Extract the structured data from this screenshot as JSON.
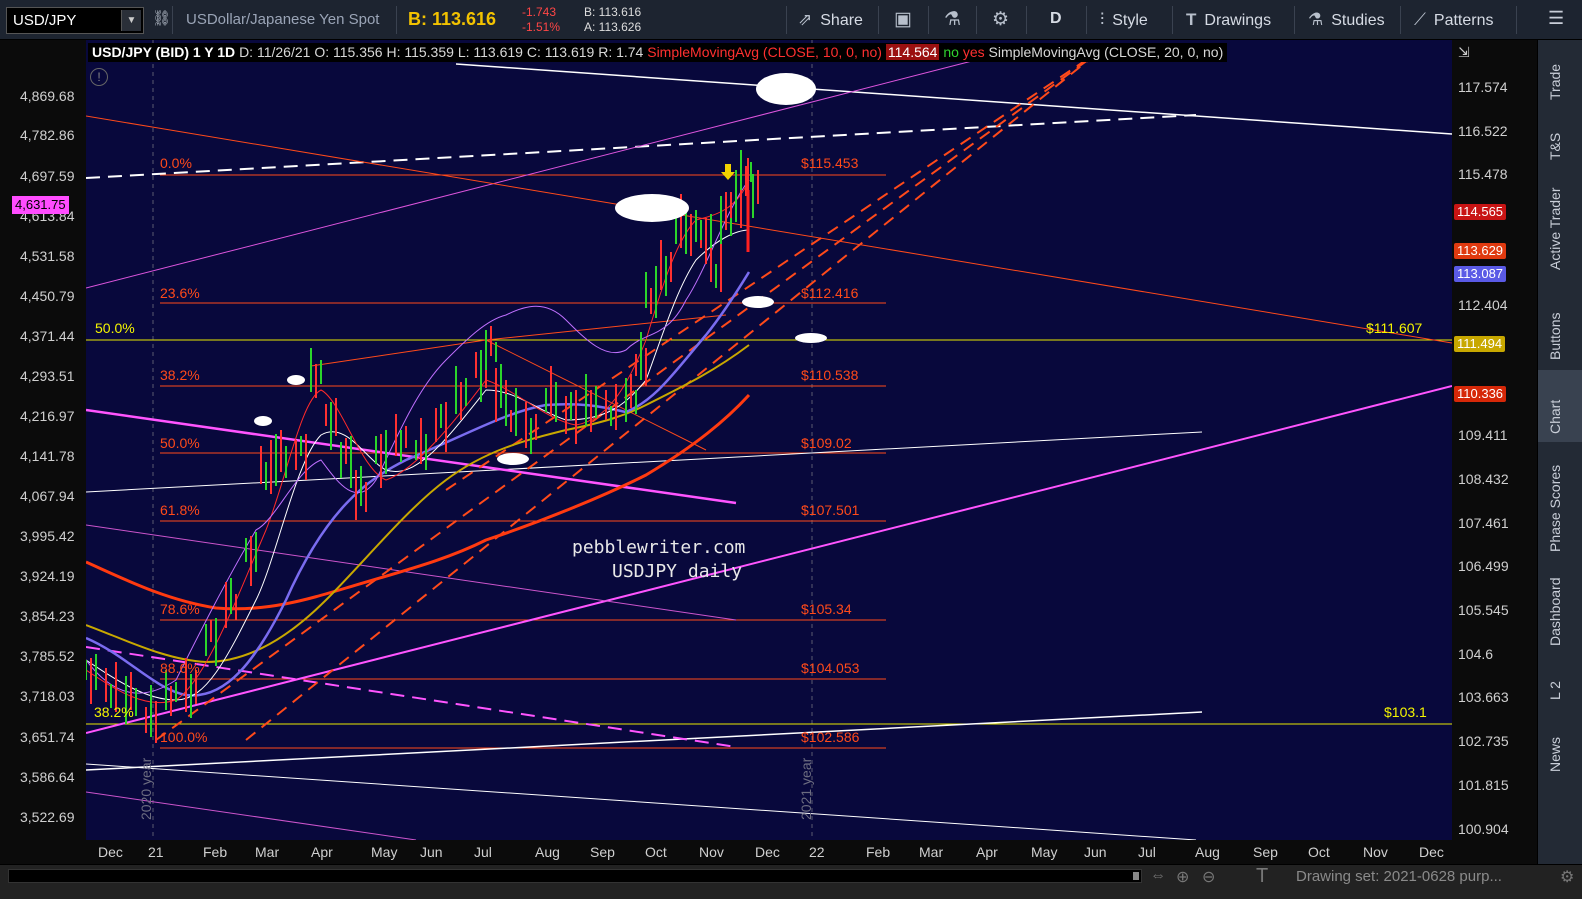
{
  "toolbar": {
    "symbol": "USD/JPY",
    "description": "USDollar/Japanese Yen Spot",
    "bid": "B: 113.616",
    "change_abs": "-1.743",
    "change_pct": "-1.51%",
    "bid_small": "B: 113.616",
    "ask_small": "A: 113.626",
    "share": "Share",
    "period": "D",
    "style": "Style",
    "drawings": "Drawings",
    "studies": "Studies",
    "patterns": "Patterns"
  },
  "legend": {
    "title": "USD/JPY (BID) 1 Y 1D",
    "date": "D: 11/26/21",
    "open": "O: 115.356",
    "high": "H: 115.359",
    "low": "L: 113.619",
    "close": "C: 113.619",
    "range": "R: 1.74",
    "sma1": "SimpleMovingAvg (CLOSE, 10, 0, no)",
    "sma1_val": "114.564",
    "flag_no": "no",
    "flag_yes": "yes",
    "sma2": "SimpleMovingAvg (CLOSE, 20, 0, no)"
  },
  "left_axis": [
    "4,869.68",
    "4,782.86",
    "4,697.59",
    "4,613.84",
    "4,531.58",
    "4,450.79",
    "4,371.44",
    "4,293.51",
    "4,216.97",
    "4,141.78",
    "4,067.94",
    "3,995.42",
    "3,924.19",
    "3,854.23",
    "3,785.52",
    "3,718.03",
    "3,651.74",
    "3,586.64",
    "3,522.69"
  ],
  "left_tag": "4,631.75",
  "right_axis": [
    "117.574",
    "116.522",
    "115.478",
    "112.404",
    "109.411",
    "108.432",
    "107.461",
    "106.499",
    "105.545",
    "104.6",
    "103.663",
    "102.735",
    "101.815",
    "100.904"
  ],
  "right_tags": [
    {
      "label": "114.565",
      "color": "#c81414"
    },
    {
      "label": "113.629",
      "color": "#e03a10"
    },
    {
      "label": "113.087",
      "color": "#5a5ae6"
    },
    {
      "label": "111.494",
      "color": "#c8a800"
    },
    {
      "label": "110.336",
      "color": "#d62808"
    }
  ],
  "x_axis": [
    "Dec",
    "21",
    "Feb",
    "Mar",
    "Apr",
    "May",
    "Jun",
    "Jul",
    "Aug",
    "Sep",
    "Oct",
    "Nov",
    "Dec",
    "22",
    "Feb",
    "Mar",
    "Apr",
    "May",
    "Jun",
    "Jul",
    "Aug",
    "Sep",
    "Oct",
    "Nov",
    "Dec"
  ],
  "fib_labels": [
    {
      "pct": "0.0%",
      "price": "$115.453"
    },
    {
      "pct": "23.6%",
      "price": "$112.416"
    },
    {
      "pct": "38.2%",
      "price": "$110.538"
    },
    {
      "pct": "50.0%",
      "price": "$109.02"
    },
    {
      "pct": "61.8%",
      "price": "$107.501"
    },
    {
      "pct": "78.6%",
      "price": "$105.34"
    },
    {
      "pct": "88.6%",
      "price": "$104.053"
    },
    {
      "pct": "100.0%",
      "price": "$102.586"
    }
  ],
  "yellow_fib": [
    {
      "pct": "50.0%",
      "price": "$111.607"
    },
    {
      "pct": "38.2%",
      "price": "$103.1"
    }
  ],
  "watermark": [
    "pebblewriter.com",
    "USDJPY daily"
  ],
  "year_labels": [
    "2020 year",
    "2021 year"
  ],
  "right_panel": [
    "Trade",
    "T&S",
    "Active Trader",
    "Buttons",
    "Chart",
    "Phase Scores",
    "Dashboard",
    "L 2",
    "News"
  ],
  "bottom": {
    "drawing_set": "Drawing set: 2021-0628 purp..."
  },
  "colors": {
    "chart_bg": "#08083c",
    "fib": "#ff4a1a",
    "yellow": "#f5f500",
    "magenta": "#ff55ff"
  }
}
